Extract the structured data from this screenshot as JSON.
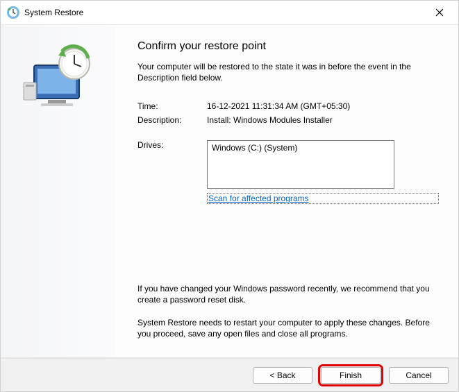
{
  "titlebar": {
    "title": "System Restore"
  },
  "main": {
    "page_title": "Confirm your restore point",
    "intro": "Your computer will be restored to the state it was in before the event in the Description field below.",
    "fields": {
      "time_label": "Time:",
      "time_value": "16-12-2021 11:31:34 AM (GMT+05:30)",
      "desc_label": "Description:",
      "desc_value": "Install: Windows Modules Installer",
      "drives_label": "Drives:",
      "drives_value": "Windows (C:) (System)"
    },
    "scan_link": "Scan for affected programs",
    "note_password": "If you have changed your Windows password recently, we recommend that you create a password reset disk.",
    "note_restart": "System Restore needs to restart your computer to apply these changes. Before you proceed, save any open files and close all programs."
  },
  "footer": {
    "back": "< Back",
    "finish": "Finish",
    "cancel": "Cancel"
  }
}
